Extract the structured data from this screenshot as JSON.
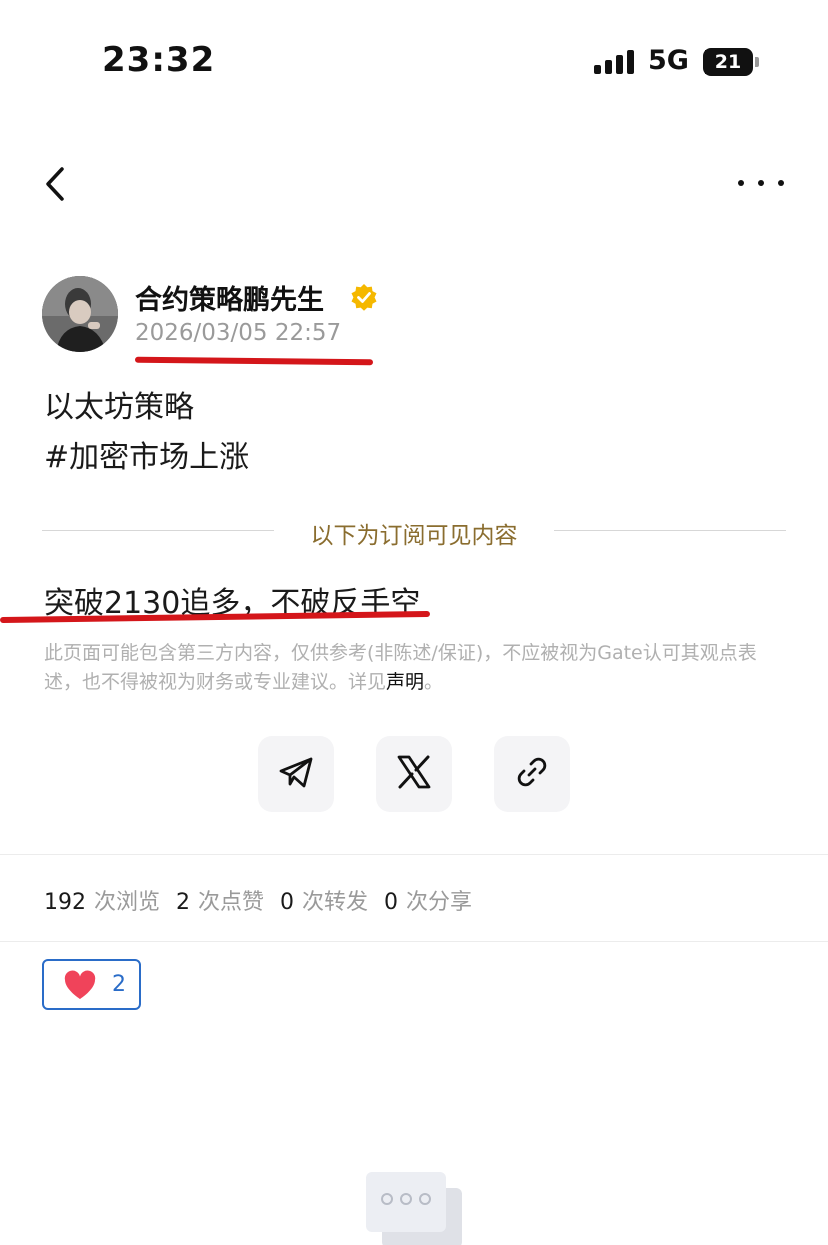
{
  "status_bar": {
    "time": "23:32",
    "network": "5G",
    "battery": "21",
    "battery_level": 0.21
  },
  "nav": {
    "back_icon": "chevron-left-icon",
    "more_icon": "more-horizontal-icon"
  },
  "author": {
    "name": "合约策略鹏先生",
    "verified_icon": "verified-badge-icon",
    "post_time": "2026/03/05 22:57"
  },
  "post": {
    "title": "以太坊策略",
    "hashtag": "#加密市场上涨",
    "subscription_divider": "以下为订阅可见内容",
    "strategy": "突破2130追多，不破反手空",
    "disclaimer": "此页面可能包含第三方内容，仅供参考(非陈述/保证)，不应被视为Gate认可其观点表述，也不得被视为财务或专业建议。详见",
    "disclaimer_link": "声明",
    "disclaimer_end": "。"
  },
  "share": {
    "icons": [
      "telegram-icon",
      "x-icon",
      "link-icon"
    ]
  },
  "stats": {
    "views": "192",
    "views_label": "次浏览",
    "likes": "2",
    "likes_label": "次点赞",
    "reposts": "0",
    "reposts_label": "次转发",
    "shares": "0",
    "shares_label": "次分享"
  },
  "reaction": {
    "icon": "heart-icon",
    "count": "2"
  },
  "colors": {
    "accent": "#2a6cc8",
    "gold_text": "#8a6d2f",
    "verified": "#f5b800",
    "heart": "#f0435a",
    "annotation": "#d4161a"
  }
}
